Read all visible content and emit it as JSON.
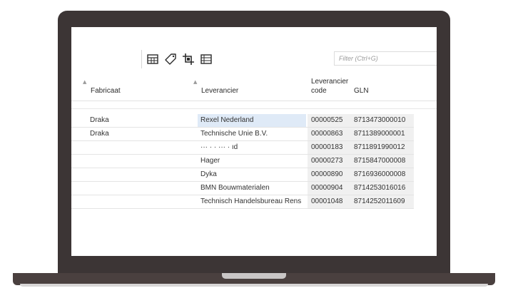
{
  "toolbar": {
    "icons": [
      "table-icon",
      "tag-icon",
      "crop-icon",
      "list-icon"
    ],
    "filter_placeholder": "Filter (Ctrl+G)"
  },
  "columns": {
    "fabricaat": "Fabricaat",
    "leverancier": "Leverancier",
    "code_line1": "Leverancier",
    "code_line2": "code",
    "gln": "GLN"
  },
  "rows": [
    {
      "fabricaat": "Draka",
      "leverancier": "Rexel Nederland",
      "code": "00000525",
      "gln": "8713473000010",
      "selected": true
    },
    {
      "fabricaat": "Draka",
      "leverancier": "Technische Unie B.V.",
      "code": "00000863",
      "gln": "8711389000001"
    },
    {
      "fabricaat": "",
      "leverancier": "··· · · ··· ·  ıd",
      "code": "00000183",
      "gln": "8711891990012"
    },
    {
      "fabricaat": "",
      "leverancier": "Hager",
      "code": "00000273",
      "gln": "8715847000008"
    },
    {
      "fabricaat": "",
      "leverancier": "Dyka",
      "code": "00000890",
      "gln": "8716936000008"
    },
    {
      "fabricaat": "",
      "leverancier": "BMN Bouwmaterialen",
      "code": "00000904",
      "gln": "8714253016016"
    },
    {
      "fabricaat": "",
      "leverancier": "Technisch Handelsbureau Rens",
      "code": "00001048",
      "gln": "8714252011609"
    }
  ]
}
